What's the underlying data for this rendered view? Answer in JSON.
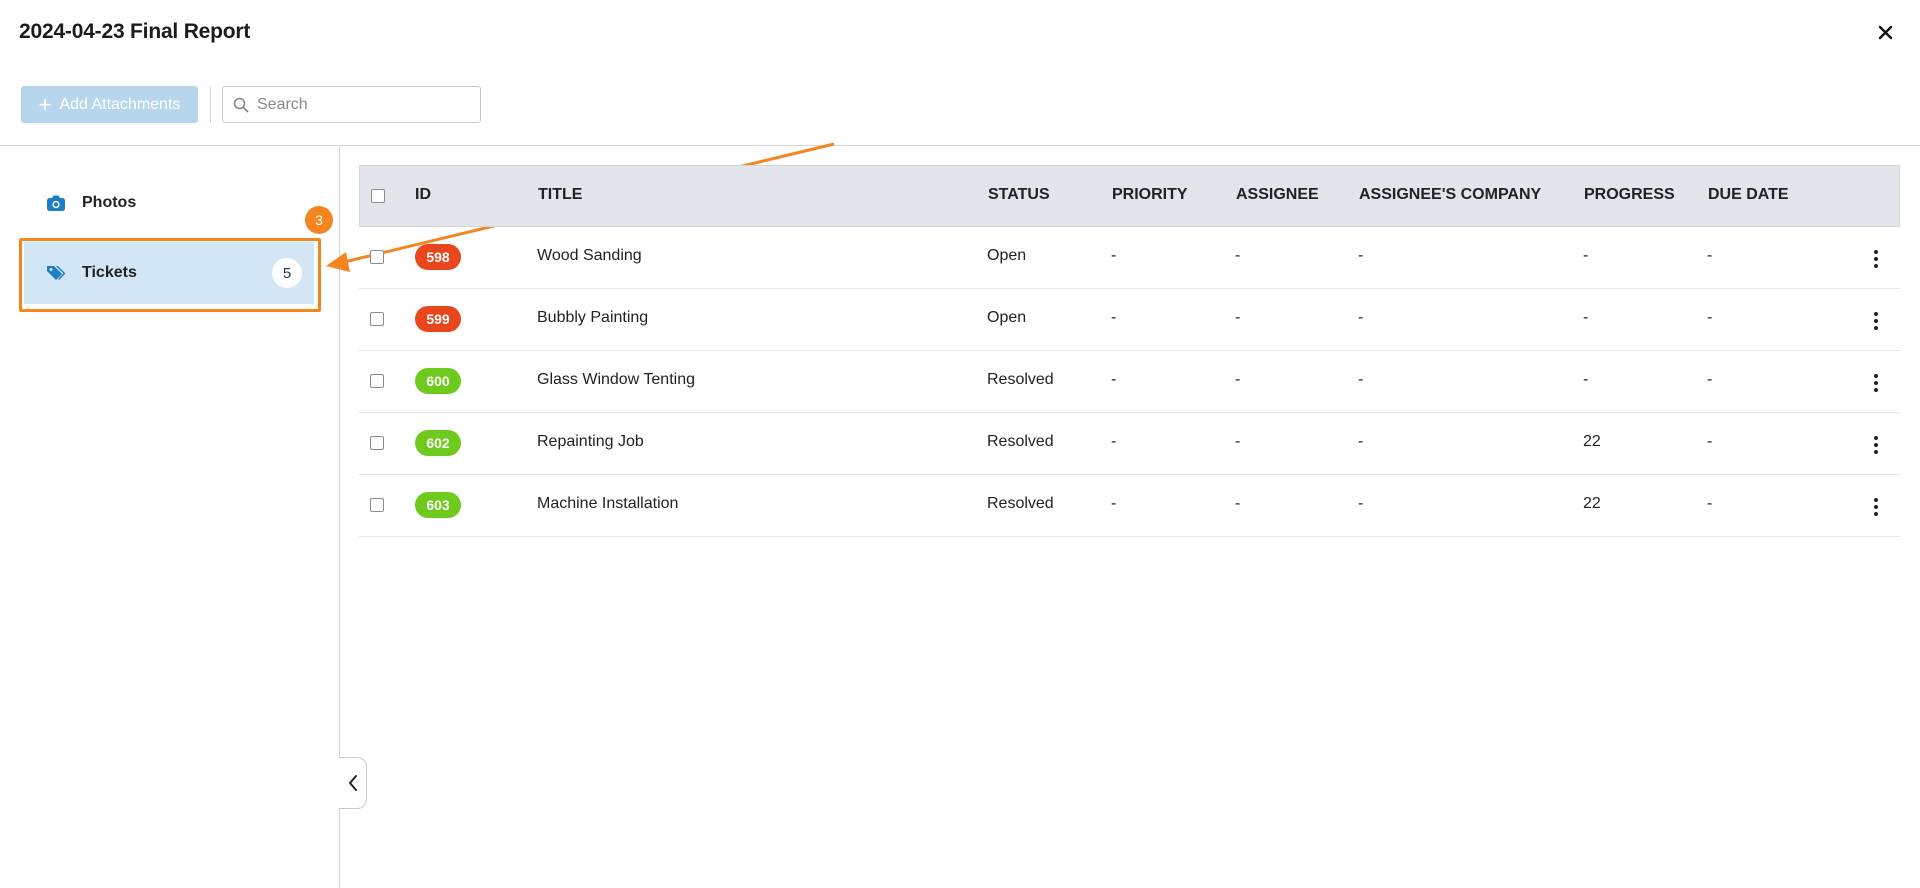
{
  "window": {
    "title": "2024-04-23 Final Report"
  },
  "toolbar": {
    "add_label": "Add Attachments",
    "search_placeholder": "Search"
  },
  "sidebar": {
    "items": [
      {
        "label": "Photos",
        "icon": "camera-icon"
      },
      {
        "label": "Tickets",
        "icon": "tags-icon",
        "count": "5",
        "selected": true
      }
    ]
  },
  "annotation": {
    "step": "3",
    "color": "#f5851f"
  },
  "table": {
    "columns": [
      "ID",
      "TITLE",
      "STATUS",
      "PRIORITY",
      "ASSIGNEE",
      "ASSIGNEE'S COMPANY",
      "PROGRESS",
      "DUE DATE"
    ],
    "rows": [
      {
        "id": "598",
        "id_color": "#e8461c",
        "title": "Wood Sanding",
        "status": "Open",
        "priority": "-",
        "assignee": "-",
        "company": "-",
        "progress": "-",
        "due": "-"
      },
      {
        "id": "599",
        "id_color": "#e8461c",
        "title": "Bubbly Painting",
        "status": "Open",
        "priority": "-",
        "assignee": "-",
        "company": "-",
        "progress": "-",
        "due": "-"
      },
      {
        "id": "600",
        "id_color": "#6ecb1e",
        "title": "Glass Window Tenting",
        "status": "Resolved",
        "priority": "-",
        "assignee": "-",
        "company": "-",
        "progress": "-",
        "due": "-"
      },
      {
        "id": "602",
        "id_color": "#6ecb1e",
        "title": "Repainting Job",
        "status": "Resolved",
        "priority": "-",
        "assignee": "-",
        "company": "-",
        "progress": "22",
        "due": "-"
      },
      {
        "id": "603",
        "id_color": "#6ecb1e",
        "title": "Machine Installation",
        "status": "Resolved",
        "priority": "-",
        "assignee": "-",
        "company": "-",
        "progress": "22",
        "due": "-"
      }
    ]
  },
  "colors": {
    "accent": "#1f7fc4",
    "selected_bg": "#d3e6f5",
    "header_bg": "#e2e6ea",
    "open_red": "#e8461c",
    "resolved_green": "#6ecb1e"
  }
}
